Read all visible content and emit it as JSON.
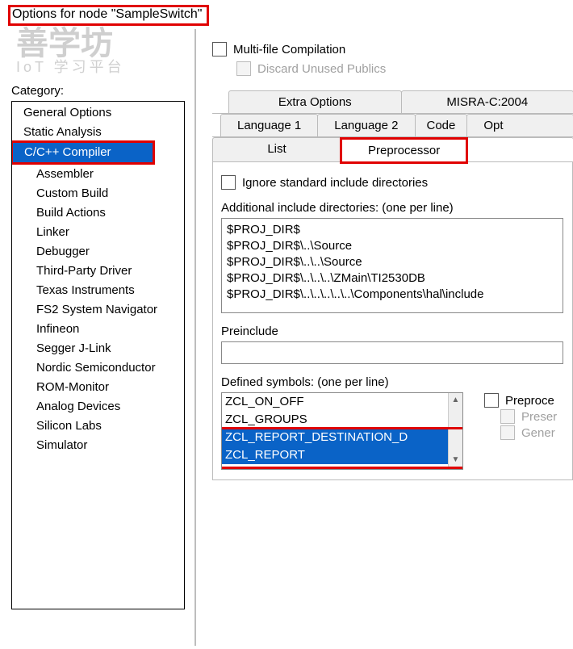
{
  "title": "Options for node \"SampleSwitch\"",
  "watermark": {
    "main": "善学坊",
    "sub": "IoT 学习平台"
  },
  "sidebar": {
    "label": "Category:",
    "items": [
      {
        "label": "General Options",
        "sub": false,
        "selected": false
      },
      {
        "label": "Static Analysis",
        "sub": false,
        "selected": false
      },
      {
        "label": "C/C++ Compiler",
        "sub": false,
        "selected": true
      },
      {
        "label": "Assembler",
        "sub": true,
        "selected": false
      },
      {
        "label": "Custom Build",
        "sub": true,
        "selected": false
      },
      {
        "label": "Build Actions",
        "sub": true,
        "selected": false
      },
      {
        "label": "Linker",
        "sub": true,
        "selected": false
      },
      {
        "label": "Debugger",
        "sub": true,
        "selected": false
      },
      {
        "label": "Third-Party Driver",
        "sub": "sub2",
        "selected": false
      },
      {
        "label": "Texas Instruments",
        "sub": "sub2",
        "selected": false
      },
      {
        "label": "FS2 System Navigator",
        "sub": "sub2",
        "selected": false
      },
      {
        "label": "Infineon",
        "sub": "sub2",
        "selected": false
      },
      {
        "label": "Segger J-Link",
        "sub": "sub2",
        "selected": false
      },
      {
        "label": "Nordic Semiconductor",
        "sub": "sub2",
        "selected": false
      },
      {
        "label": "ROM-Monitor",
        "sub": "sub2",
        "selected": false
      },
      {
        "label": "Analog Devices",
        "sub": "sub2",
        "selected": false
      },
      {
        "label": "Silicon Labs",
        "sub": "sub2",
        "selected": false
      },
      {
        "label": "Simulator",
        "sub": "sub2",
        "selected": false
      }
    ]
  },
  "panel": {
    "multiFile": "Multi-file Compilation",
    "discard": "Discard Unused Publics",
    "tabsRow1": [
      "Extra Options",
      "MISRA-C:2004"
    ],
    "tabsRow2": [
      "Language 1",
      "Language 2",
      "Code",
      "Opt"
    ],
    "tabsRow3": [
      "List",
      "Preprocessor"
    ],
    "ignoreStd": "Ignore standard include directories",
    "addlInclLabel": "Additional include directories: (one per line)",
    "addlIncl": "$PROJ_DIR$\n$PROJ_DIR$\\..\\Source\n$PROJ_DIR$\\..\\..\\Source\n$PROJ_DIR$\\..\\..\\..\\ZMain\\TI2530DB\n$PROJ_DIR$\\..\\..\\..\\..\\..\\Components\\hal\\include",
    "preincludeLabel": "Preinclude",
    "preinclude": "",
    "definedLabel": "Defined symbols: (one per line)",
    "defined": [
      "ZCL_ON_OFF",
      "ZCL_GROUPS",
      "ZCL_REPORT_DESTINATION_D",
      "ZCL_REPORT"
    ],
    "preprocOut": "Preproce",
    "preserve": "Preser",
    "generate": "Gener"
  }
}
